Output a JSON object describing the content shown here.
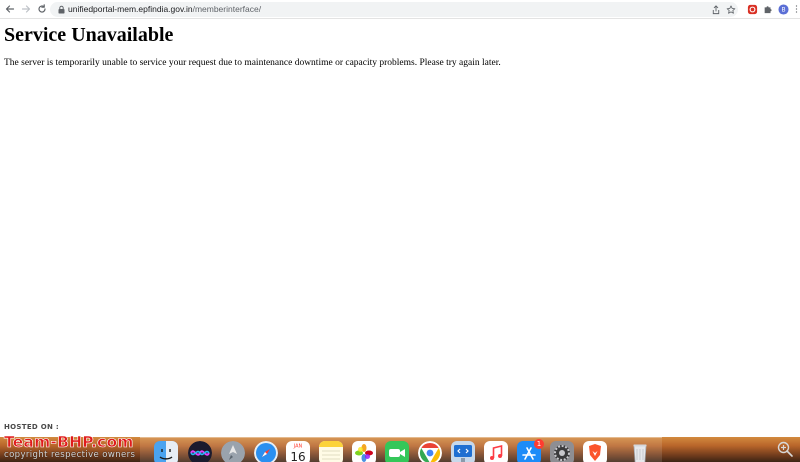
{
  "browser": {
    "url_host": "unifiedportal-mem.epfindia.gov.in",
    "url_path": "/memberinterface/",
    "profile_initial": "B",
    "nav_icons": [
      "back-arrow-icon",
      "forward-arrow-icon",
      "reload-icon"
    ],
    "omnibox_icons": [
      "lock-icon",
      "share-icon",
      "star-bookmark-icon"
    ],
    "extension_icons": [
      "red-extension-icon",
      "puzzle-extensions-icon",
      "profile-avatar"
    ]
  },
  "page": {
    "title": "Service Unavailable",
    "message": "The server is temporarily unable to service your request due to maintenance downtime or capacity problems. Please try again later."
  },
  "watermark": {
    "hosted_on": "HOSTED ON :",
    "logo_text": "Team-BHP.com",
    "copyright": "copyright respective owners"
  },
  "dock": {
    "calendar_month": "JAN",
    "calendar_day": "16",
    "app_store_badge": "1",
    "apps": [
      "finder-icon",
      "siri-icon",
      "launchpad-icon",
      "safari-icon",
      "calendar-icon",
      "notes-icon",
      "photos-icon",
      "facetime-icon",
      "chrome-icon",
      "xcode-preview-icon",
      "music-icon",
      "app-store-icon",
      "system-preferences-icon",
      "brave-icon",
      "trash-icon"
    ]
  },
  "colors": {
    "omnibox_bg": "#f1f3f4",
    "dock_top": "#d28a3e",
    "dock_bottom": "#3c2414",
    "logo_red": "#e01b1b"
  }
}
